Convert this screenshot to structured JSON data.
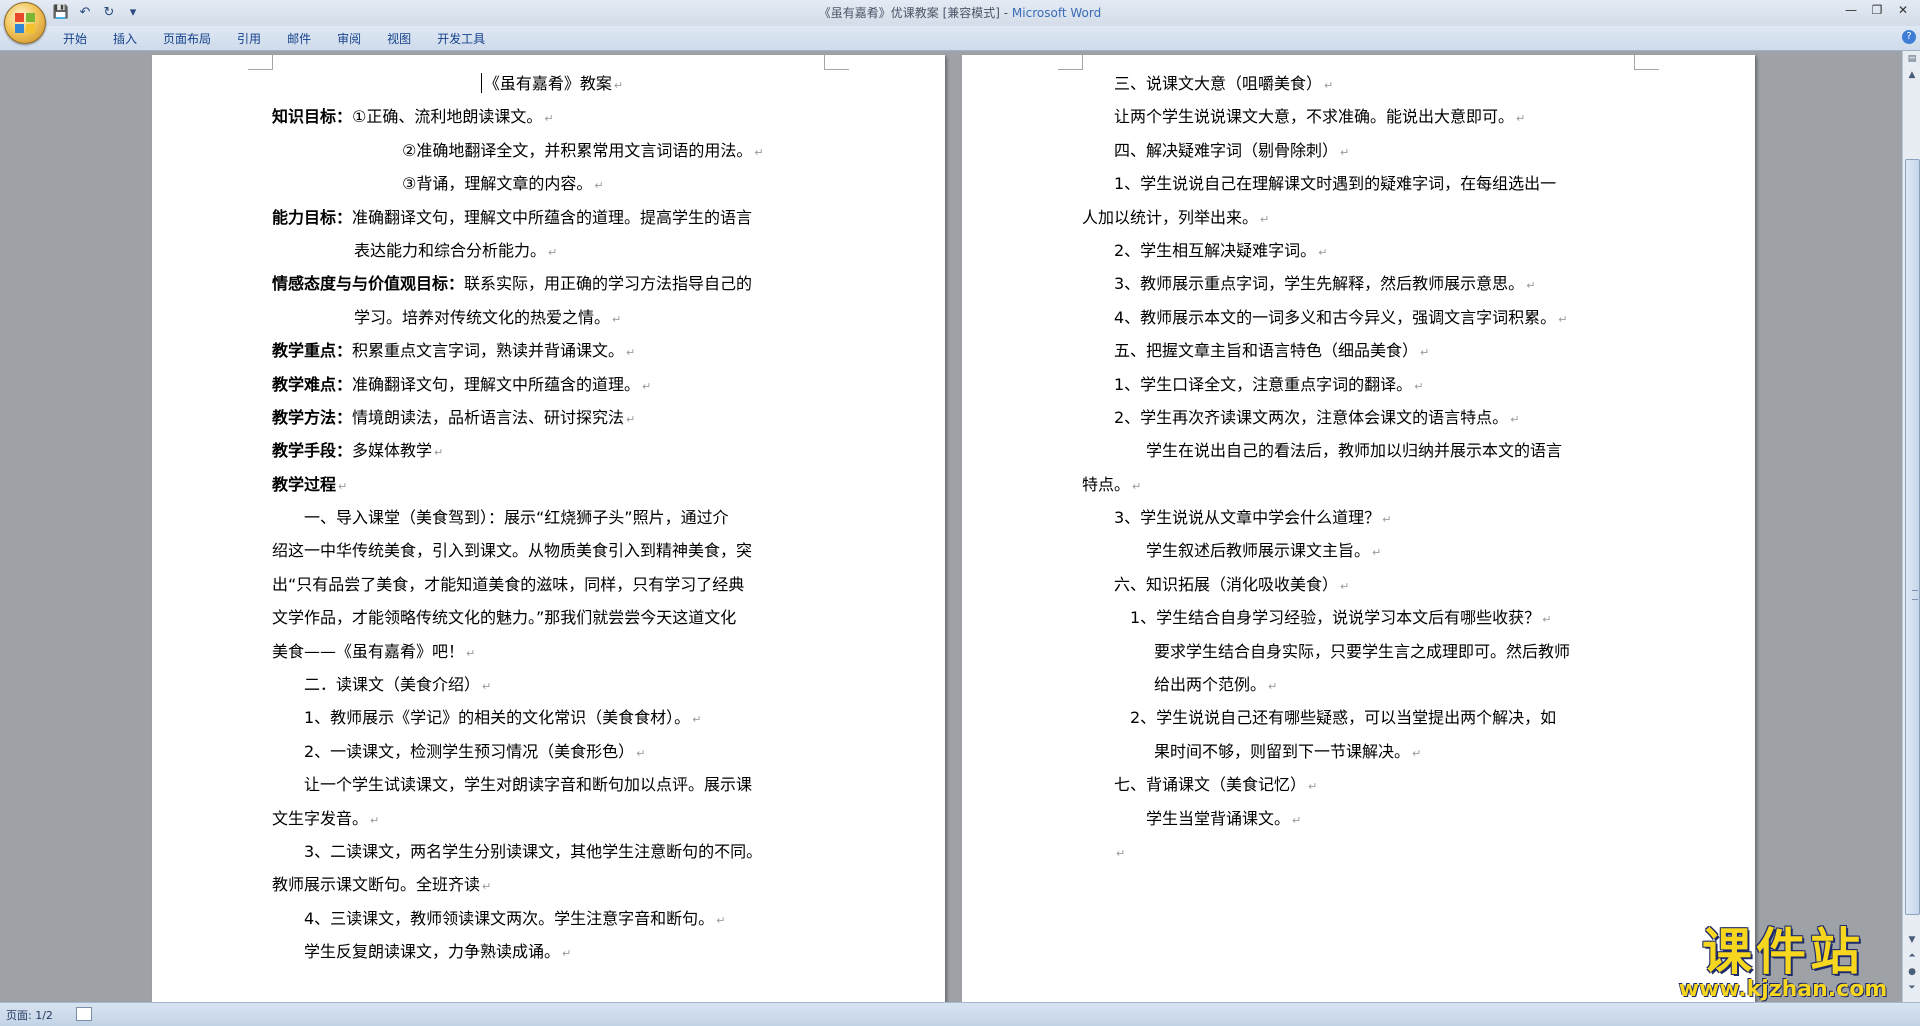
{
  "window": {
    "title": "《虽有嘉肴》优课教案 [兼容模式] - ",
    "app": "Microsoft Word",
    "controls": [
      "—",
      "❐",
      "✕"
    ]
  },
  "quick_access": {
    "save_icon": "💾",
    "undo_icon": "↶",
    "redo_icon": "↻",
    "customize_icon": "▾"
  },
  "ribbon": {
    "tabs": [
      "开始",
      "插入",
      "页面布局",
      "引用",
      "邮件",
      "审阅",
      "视图",
      "开发工具"
    ],
    "help": "?"
  },
  "para_mark": "↵",
  "left_page": {
    "title": "《虽有嘉肴》教案",
    "lines": [
      {
        "label": "知识目标：",
        "text": "①正确、流利地朗读课文。",
        "indent": 0
      },
      {
        "label": "",
        "text": "②准确地翻译全文，并积累常用文言词语的用法。",
        "indent": 130
      },
      {
        "label": "",
        "text": "③背诵，理解文章的内容。",
        "indent": 130
      },
      {
        "label": "能力目标：",
        "text": "准确翻译文句，理解文中所蕴含的道理。提高学生的语言",
        "indent": 0,
        "nomark": true
      },
      {
        "label": "",
        "text": "表达能力和综合分析能力。",
        "indent": 82
      },
      {
        "label": "情感态度与与价值观目标：",
        "text": "联系实际，用正确的学习方法指导自己的",
        "indent": 0,
        "nomark": true
      },
      {
        "label": "",
        "text": "学习。培养对传统文化的热爱之情。",
        "indent": 82
      },
      {
        "label": "教学重点：",
        "text": "积累重点文言字词，熟读并背诵课文。",
        "indent": 0
      },
      {
        "label": "教学难点：",
        "text": "准确翻译文句，理解文中所蕴含的道理。",
        "indent": 0
      },
      {
        "label": "教学方法：",
        "text": "情境朗读法，品析语言法、研讨探究法",
        "indent": 0
      },
      {
        "label": "教学手段：",
        "text": "多媒体教学",
        "indent": 0
      },
      {
        "label": "教学过程",
        "text": "",
        "indent": 0
      },
      {
        "label": "",
        "text": "一、导入课堂（美食驾到）：展示“红烧狮子头”照片，通过介",
        "indent": 32,
        "nomark": true
      },
      {
        "label": "",
        "text": "绍这一中华传统美食，引入到课文。从物质美食引入到精神美食，突",
        "indent": 0,
        "nomark": true
      },
      {
        "label": "",
        "text": "出“只有品尝了美食，才能知道美食的滋味，同样，只有学习了经典",
        "indent": 0,
        "nomark": true
      },
      {
        "label": "",
        "text": "文学作品，才能领略传统文化的魅力。”那我们就尝尝今天这道文化",
        "indent": 0,
        "nomark": true
      },
      {
        "label": "",
        "text": "美食——《虽有嘉肴》吧！",
        "indent": 0
      },
      {
        "label": "",
        "text": "二．读课文（美食介绍）",
        "indent": 32
      },
      {
        "label": "",
        "text": "1、教师展示《学记》的相关的文化常识（美食食材）。",
        "indent": 32
      },
      {
        "label": "",
        "text": "2、一读课文，检测学生预习情况（美食形色）",
        "indent": 32
      },
      {
        "label": "",
        "text": "让一个学生试读课文，学生对朗读字音和断句加以点评。展示课",
        "indent": 32,
        "nomark": true
      },
      {
        "label": "",
        "text": "文生字发音。",
        "indent": 0
      },
      {
        "label": "",
        "text": "3、二读课文，两名学生分别读课文，其他学生注意断句的不同。",
        "indent": 32,
        "nomark": true
      },
      {
        "label": "",
        "text": "教师展示课文断句。全班齐读",
        "indent": 0
      },
      {
        "label": "",
        "text": "4、三读课文，教师领读课文两次。学生注意字音和断句。",
        "indent": 32
      },
      {
        "label": "",
        "text": "学生反复朗读课文，力争熟读成诵。",
        "indent": 32
      }
    ]
  },
  "right_page": {
    "lines": [
      {
        "text": "三、说课文大意（咀嚼美食）",
        "indent": 32
      },
      {
        "text": "让两个学生说说课文大意，不求准确。能说出大意即可。",
        "indent": 32
      },
      {
        "text": "四、解决疑难字词（剔骨除刺）",
        "indent": 32
      },
      {
        "text": "1、学生说说自己在理解课文时遇到的疑难字词，在每组选出一",
        "indent": 32,
        "nomark": true
      },
      {
        "text": "人加以统计，列举出来。",
        "indent": 0
      },
      {
        "text": "2、学生相互解决疑难字词。",
        "indent": 32
      },
      {
        "text": "3、教师展示重点字词，学生先解释，然后教师展示意思。",
        "indent": 32
      },
      {
        "text": "4、教师展示本文的一词多义和古今异义，强调文言字词积累。",
        "indent": 32
      },
      {
        "text": "五、把握文章主旨和语言特色（细品美食）",
        "indent": 32
      },
      {
        "text": "1、学生口译全文，注意重点字词的翻译。",
        "indent": 32
      },
      {
        "text": "2、学生再次齐读课文两次，注意体会课文的语言特点。",
        "indent": 32
      },
      {
        "text": "学生在说出自己的看法后，教师加以归纳并展示本文的语言",
        "indent": 64,
        "nomark": true
      },
      {
        "text": "特点。",
        "indent": 0
      },
      {
        "text": "3、学生说说从文章中学会什么道理？",
        "indent": 32
      },
      {
        "text": "学生叙述后教师展示课文主旨。",
        "indent": 64
      },
      {
        "text": "六、知识拓展（消化吸收美食）",
        "indent": 32
      },
      {
        "text": "1、学生结合自身学习经验，说说学习本文后有哪些收获？",
        "indent": 48
      },
      {
        "text": "要求学生结合自身实际，只要学生言之成理即可。然后教师",
        "indent": 72,
        "nomark": true
      },
      {
        "text": "给出两个范例。",
        "indent": 72
      },
      {
        "text": "2、学生说说自己还有哪些疑惑，可以当堂提出两个解决，如",
        "indent": 48,
        "nomark": true
      },
      {
        "text": "果时间不够，则留到下一节课解决。",
        "indent": 72
      },
      {
        "text": "七、背诵课文（美食记忆）",
        "indent": 32
      },
      {
        "text": "学生当堂背诵课文。",
        "indent": 64
      },
      {
        "text": "",
        "indent": 32
      }
    ]
  },
  "statusbar": {
    "page": "页面: 1/2"
  },
  "watermark": {
    "text": "课件站",
    "url": "www.kjzhan.com"
  },
  "colors": {
    "accent": "#15428b",
    "watermark": "#f6d61f",
    "watermark_outline": "#1d2a6b"
  }
}
